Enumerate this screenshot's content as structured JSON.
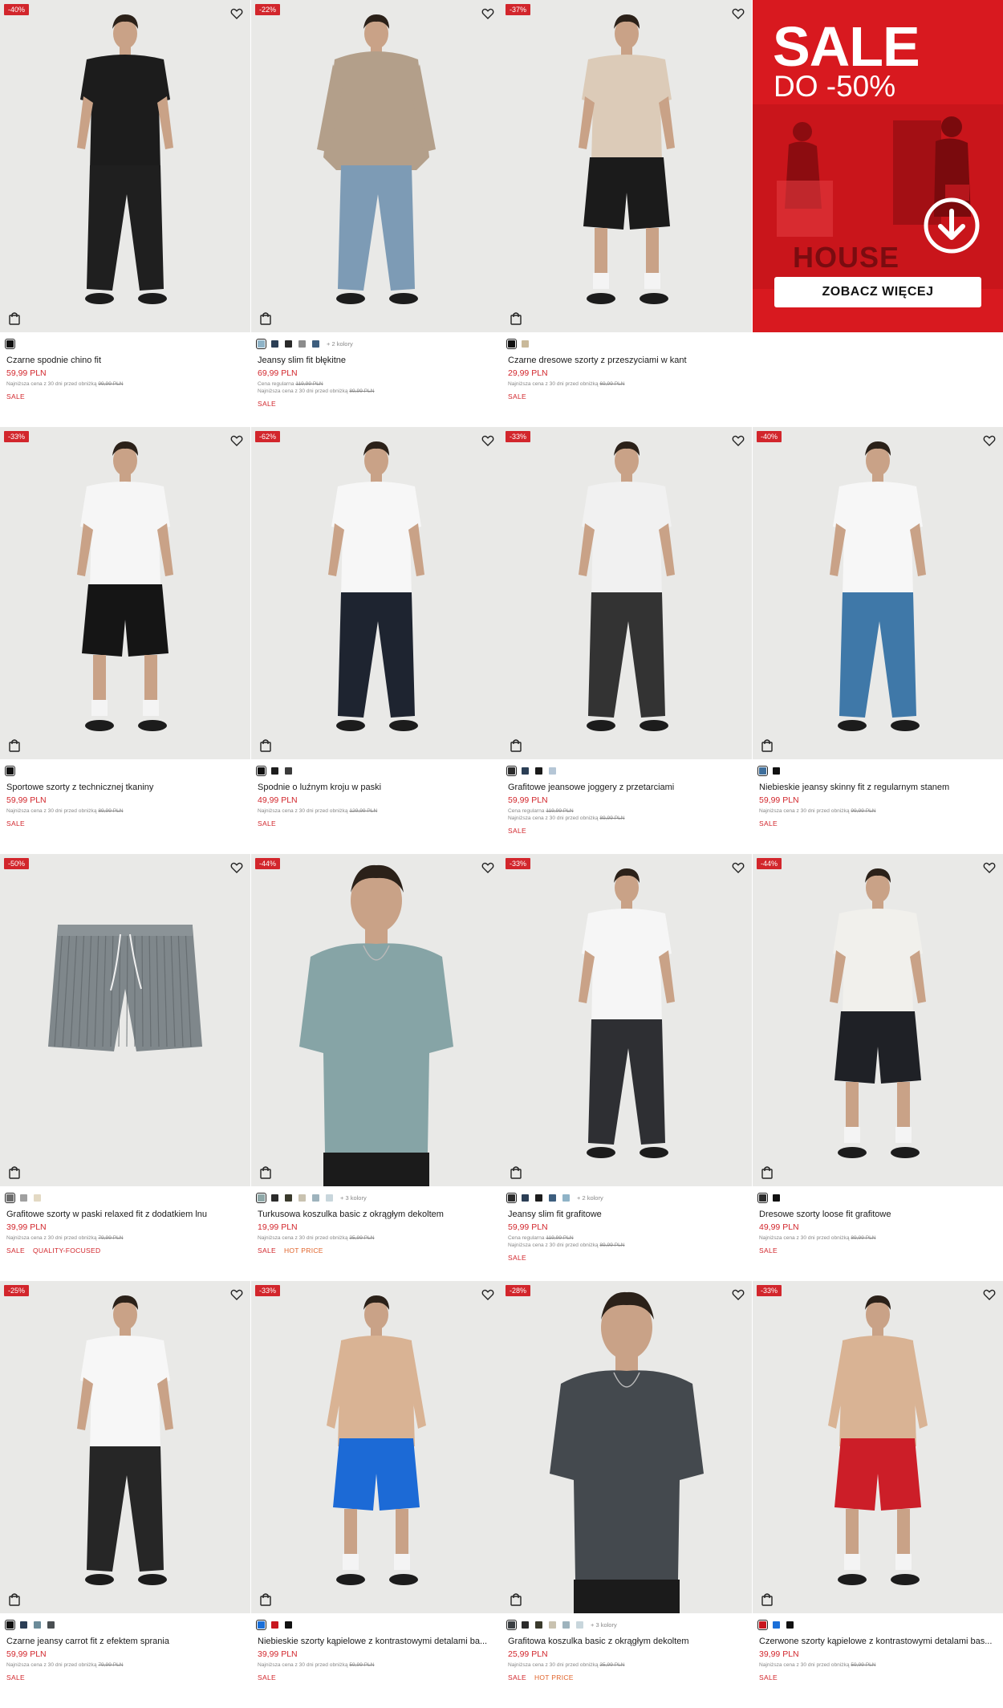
{
  "promo": {
    "title": "SALE",
    "subtitle": "DO -50%",
    "brand": "HOUSE",
    "button_label": "ZOBACZ WIĘCEJ"
  },
  "colors": {
    "sale_red": "#d2262c",
    "hot_orange": "#e0632a",
    "photo_bg": "#e9e9e7"
  },
  "products": [
    {
      "discount": "-40%",
      "name": "Czarne spodnie chino fit",
      "price": "59,99 PLN",
      "regular": "",
      "lowest_label": "Najniższa cena z 30 dni przed obniżką",
      "lowest_price": "99,99 PLN",
      "tags": [
        "SALE"
      ],
      "more": "",
      "swatches": [
        "#111111"
      ],
      "model": {
        "top": "#1c1c1c",
        "bottom": "#1f1f1f",
        "shorts": false,
        "shirtless": false,
        "hood": false
      }
    },
    {
      "discount": "-22%",
      "name": "Jeansy slim fit błękitne",
      "price": "69,99 PLN",
      "regular_label": "Cena regularna",
      "regular": "119,99 PLN",
      "lowest_label": "Najniższa cena z 30 dni przed obniżką",
      "lowest_price": "89,99 PLN",
      "tags": [
        "SALE"
      ],
      "more": "+ 2 kolory",
      "swatches": [
        "#8fb3c7",
        "#2b3e55",
        "#2a2a2a",
        "#8c8c8c",
        "#3d5e7e"
      ],
      "model": {
        "top": "#b39f8a",
        "bottom": "#7d9bb5",
        "shorts": false,
        "shirtless": false,
        "hood": true
      }
    },
    {
      "discount": "-37%",
      "name": "Czarne dresowe szorty z przeszyciami w kant",
      "price": "29,99 PLN",
      "regular": "",
      "lowest_label": "Najniższa cena z 30 dni przed obniżką",
      "lowest_price": "69,99 PLN",
      "tags": [
        "SALE"
      ],
      "more": "",
      "swatches": [
        "#111111",
        "#c9b99a"
      ],
      "model": {
        "top": "#dccbb8",
        "bottom": "#1b1b1b",
        "shorts": true,
        "shirtless": false,
        "hood": false
      }
    },
    {
      "discount": "-33%",
      "name": "Sportowe szorty z technicznej tkaniny",
      "price": "59,99 PLN",
      "regular": "",
      "lowest_label": "Najniższa cena z 30 dni przed obniżką",
      "lowest_price": "89,99 PLN",
      "tags": [
        "SALE"
      ],
      "more": "",
      "swatches": [
        "#111111"
      ],
      "model": {
        "top": "#f6f6f6",
        "bottom": "#151515",
        "shorts": true,
        "shirtless": false,
        "hood": false
      }
    },
    {
      "discount": "-62%",
      "name": "Spodnie o luźnym kroju w paski",
      "price": "49,99 PLN",
      "regular": "",
      "lowest_label": "Najniższa cena z 30 dni przed obniżką",
      "lowest_price": "129,99 PLN",
      "tags": [
        "SALE"
      ],
      "more": "",
      "swatches": [
        "#111111",
        "#1d1d1d",
        "#3b3b3b"
      ],
      "model": {
        "top": "#f7f7f7",
        "bottom": "#1e2430",
        "shorts": false,
        "shirtless": false,
        "hood": false
      }
    },
    {
      "discount": "-33%",
      "name": "Grafitowe jeansowe joggery z przetarciami",
      "price": "59,99 PLN",
      "regular_label": "Cena regularna",
      "regular": "119,99 PLN",
      "lowest_label": "Najniższa cena z 30 dni przed obniżką",
      "lowest_price": "89,99 PLN",
      "tags": [
        "SALE"
      ],
      "more": "",
      "swatches": [
        "#2c2c2c",
        "#2b3e55",
        "#1a1a1a",
        "#b5c6d6"
      ],
      "model": {
        "top": "#f1f1f1",
        "bottom": "#333333",
        "shorts": false,
        "shirtless": false,
        "hood": false
      }
    },
    {
      "discount": "-40%",
      "name": "Niebieskie jeansy skinny fit z regularnym stanem",
      "price": "59,99 PLN",
      "regular": "",
      "lowest_label": "Najniższa cena z 30 dni przed obniżką",
      "lowest_price": "99,99 PLN",
      "tags": [
        "SALE"
      ],
      "more": "",
      "swatches": [
        "#3f6f9c",
        "#111111"
      ],
      "model": {
        "top": "#f7f7f7",
        "bottom": "#3f78a8",
        "shorts": false,
        "shirtless": false,
        "hood": false
      }
    },
    {
      "discount": "-50%",
      "name": "Grafitowe szorty w paski relaxed fit z dodatkiem lnu",
      "price": "39,99 PLN",
      "regular": "",
      "lowest_label": "Najniższa cena z 30 dni przed obniżką",
      "lowest_price": "79,99 PLN",
      "tags": [
        "SALE",
        "QUALITY-FOCUSED"
      ],
      "more": "",
      "swatches": [
        "#6d6d6d",
        "#a0a0a0",
        "#e3d9c3"
      ],
      "model": {
        "flat": true,
        "bottom": "#7f878b"
      }
    },
    {
      "discount": "-44%",
      "name": "Turkusowa koszulka basic z okrągłym dekoltem",
      "price": "19,99 PLN",
      "regular": "",
      "lowest_label": "Najniższa cena z 30 dni przed obniżką",
      "lowest_price": "35,99 PLN",
      "tags": [
        "SALE",
        "HOT PRICE"
      ],
      "more": "+ 3 kolory",
      "swatches": [
        "#8fa8a8",
        "#2b2b2b",
        "#3a3a2c",
        "#c9c2b0",
        "#9eb3bd",
        "#c8d6dc"
      ],
      "model": {
        "top": "#86a4a6",
        "bottom": "#1b1b1b",
        "shorts": false,
        "shirtless": false,
        "hood": false,
        "crop": true
      }
    },
    {
      "discount": "-33%",
      "name": "Jeansy slim fit grafitowe",
      "price": "59,99 PLN",
      "regular_label": "Cena regularna",
      "regular": "119,99 PLN",
      "lowest_label": "Najniższa cena z 30 dni przed obniżką",
      "lowest_price": "89,99 PLN",
      "tags": [
        "SALE"
      ],
      "more": "+ 2 kolory",
      "swatches": [
        "#2c2c2c",
        "#2b3e55",
        "#1c1c1c",
        "#3d5e7e",
        "#8fb3c7"
      ],
      "model": {
        "top": "#f6f6f6",
        "bottom": "#2e2f33",
        "shorts": false,
        "shirtless": false,
        "hood": false
      }
    },
    {
      "discount": "-44%",
      "name": "Dresowe szorty loose fit grafitowe",
      "price": "49,99 PLN",
      "regular": "",
      "lowest_label": "Najniższa cena z 30 dni przed obniżką",
      "lowest_price": "89,99 PLN",
      "tags": [
        "SALE"
      ],
      "more": "",
      "swatches": [
        "#2c2c2c",
        "#111111"
      ],
      "model": {
        "top": "#f1f0ec",
        "bottom": "#1f2126",
        "shorts": true,
        "shirtless": false,
        "hood": false
      }
    },
    {
      "discount": "-25%",
      "name": "Czarne jeansy carrot fit z efektem sprania",
      "price": "59,99 PLN",
      "regular": "",
      "lowest_label": "Najniższa cena z 30 dni przed obniżką",
      "lowest_price": "79,99 PLN",
      "tags": [
        "SALE"
      ],
      "more": "",
      "swatches": [
        "#111111",
        "#2b3e55",
        "#6b8b99",
        "#4a4f52"
      ],
      "model": {
        "top": "#f7f7f7",
        "bottom": "#262626",
        "shorts": false,
        "shirtless": false,
        "hood": false
      }
    },
    {
      "discount": "-33%",
      "name": "Niebieskie szorty kąpielowe z kontrastowymi detalami ba...",
      "price": "39,99 PLN",
      "regular": "",
      "lowest_label": "Najniższa cena z 30 dni przed obniżką",
      "lowest_price": "59,99 PLN",
      "tags": [
        "SALE"
      ],
      "more": "",
      "swatches": [
        "#1a6fd8",
        "#c8161e",
        "#111111"
      ],
      "model": {
        "top": "#d9b394",
        "bottom": "#1c6ad6",
        "shorts": true,
        "shirtless": true,
        "hood": false
      }
    },
    {
      "discount": "-28%",
      "name": "Grafitowa koszulka basic z okrągłym dekoltem",
      "price": "25,99 PLN",
      "regular": "",
      "lowest_label": "Najniższa cena z 30 dni przed obniżką",
      "lowest_price": "35,99 PLN",
      "tags": [
        "SALE",
        "HOT PRICE"
      ],
      "more": "+ 3 kolory",
      "swatches": [
        "#3b3f43",
        "#2b2b2b",
        "#3a3a2c",
        "#c9c2b0",
        "#9eb3bd",
        "#c8d6dc"
      ],
      "model": {
        "top": "#44494e",
        "bottom": "#1b1b1b",
        "shorts": false,
        "shirtless": false,
        "hood": false,
        "crop": true
      }
    },
    {
      "discount": "-33%",
      "name": "Czerwone szorty kąpielowe z kontrastowymi detalami bas...",
      "price": "39,99 PLN",
      "regular": "",
      "lowest_label": "Najniższa cena z 30 dni przed obniżką",
      "lowest_price": "59,99 PLN",
      "tags": [
        "SALE"
      ],
      "more": "",
      "swatches": [
        "#c8161e",
        "#1a6fd8",
        "#111111"
      ],
      "model": {
        "top": "#d9b394",
        "bottom": "#cc1e28",
        "shorts": true,
        "shirtless": true,
        "hood": false
      }
    }
  ]
}
